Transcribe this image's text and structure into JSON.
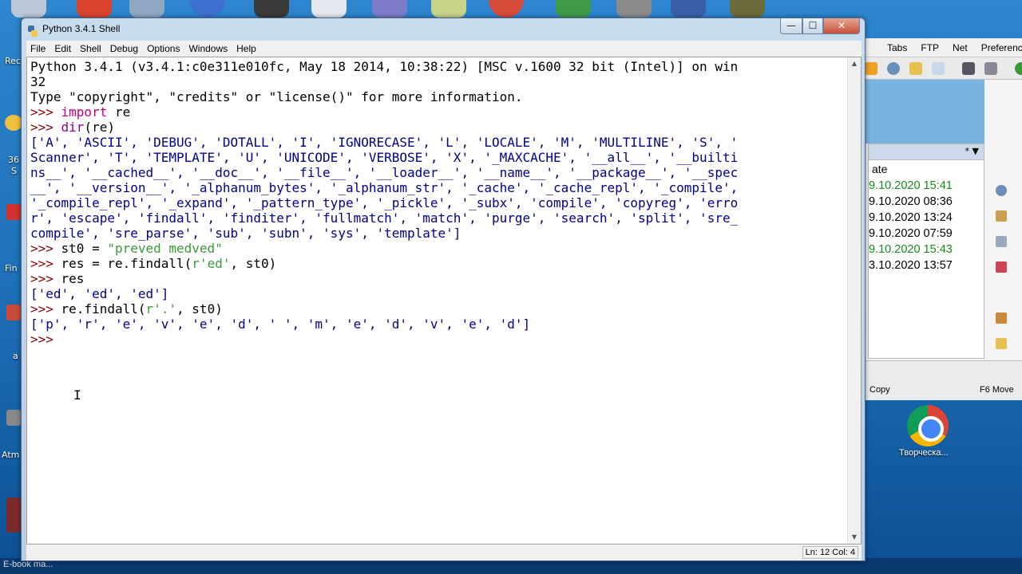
{
  "window": {
    "title": "Python 3.4.1 Shell",
    "minimize_glyph": "—",
    "maximize_glyph": "☐",
    "close_glyph": "✕"
  },
  "menu": [
    "File",
    "Edit",
    "Shell",
    "Debug",
    "Options",
    "Windows",
    "Help"
  ],
  "shell_lines": [
    [
      {
        "t": "Python 3.4.1 (v3.4.1:c0e311e010fc, May 18 2014, 10:38:22) [MSC v.1600 32 bit (Intel)] on win",
        "c": ""
      }
    ],
    [
      {
        "t": "32",
        "c": ""
      }
    ],
    [
      {
        "t": "Type \"copyright\", \"credits\" or \"license()\" for more information.",
        "c": ""
      }
    ],
    [
      {
        "t": ">>> ",
        "c": "prm"
      },
      {
        "t": "import",
        "c": "kw"
      },
      {
        "t": " re",
        "c": ""
      }
    ],
    [
      {
        "t": ">>> ",
        "c": "prm"
      },
      {
        "t": "dir",
        "c": "bi"
      },
      {
        "t": "(re)",
        "c": ""
      }
    ],
    [
      {
        "t": "['A', 'ASCII', 'DEBUG', 'DOTALL', 'I', 'IGNORECASE', 'L', 'LOCALE', 'M', 'MULTILINE', 'S', '",
        "c": "out"
      }
    ],
    [
      {
        "t": "Scanner', 'T', 'TEMPLATE', 'U', 'UNICODE', 'VERBOSE', 'X', '_MAXCACHE', '__all__', '__builti",
        "c": "out"
      }
    ],
    [
      {
        "t": "ns__', '__cached__', '__doc__', '__file__', '__loader__', '__name__', '__package__', '__spec",
        "c": "out"
      }
    ],
    [
      {
        "t": "__', '__version__', '_alphanum_bytes', '_alphanum_str', '_cache', '_cache_repl', '_compile',",
        "c": "out"
      }
    ],
    [
      {
        "t": "'_compile_repl', '_expand', '_pattern_type', '_pickle', '_subx', 'compile', 'copyreg', 'erro",
        "c": "out"
      }
    ],
    [
      {
        "t": "r', 'escape', 'findall', 'finditer', 'fullmatch', 'match', 'purge', 'search', 'split', 'sre_",
        "c": "out"
      }
    ],
    [
      {
        "t": "compile', 'sre_parse', 'sub', 'subn', 'sys', 'template']",
        "c": "out"
      }
    ],
    [
      {
        "t": ">>> ",
        "c": "prm"
      },
      {
        "t": "st0 = ",
        "c": ""
      },
      {
        "t": "\"preved medved\"",
        "c": "str"
      }
    ],
    [
      {
        "t": ">>> ",
        "c": "prm"
      },
      {
        "t": "res = re.findall(",
        "c": ""
      },
      {
        "t": "r'ed'",
        "c": "str"
      },
      {
        "t": ", st0)",
        "c": ""
      }
    ],
    [
      {
        "t": ">>> ",
        "c": "prm"
      },
      {
        "t": "res",
        "c": ""
      }
    ],
    [
      {
        "t": "['ed', 'ed', 'ed']",
        "c": "out"
      }
    ],
    [
      {
        "t": ">>> ",
        "c": "prm"
      },
      {
        "t": "re.findall(",
        "c": ""
      },
      {
        "t": "r'.'",
        "c": "str"
      },
      {
        "t": ", st0)",
        "c": ""
      }
    ],
    [
      {
        "t": "['p', 'r', 'e', 'v', 'e', 'd', ' ', 'm', 'e', 'd', 'v', 'e', 'd']",
        "c": "out"
      }
    ],
    [
      {
        "t": ">>> ",
        "c": "prm"
      }
    ]
  ],
  "status": {
    "position": "Ln: 12 Col: 4"
  },
  "background_app": {
    "menu": [
      "Tabs",
      "FTP",
      "Net",
      "Preferences"
    ],
    "column_header": "ate",
    "rows": [
      {
        "text": "9.10.2020 15:41",
        "color": "#1a8a1a"
      },
      {
        "text": "9.10.2020 08:36",
        "color": "#000000"
      },
      {
        "text": "9.10.2020 13:24",
        "color": "#000000"
      },
      {
        "text": "9.10.2020 07:59",
        "color": "#000000"
      },
      {
        "text": "9.10.2020 15:43",
        "color": "#1a8a1a"
      },
      {
        "text": "3.10.2020 13:57",
        "color": "#000000"
      }
    ],
    "bottom_left": "Copy",
    "bottom_right": "F6 Move",
    "head_glyph": "* ▼"
  },
  "desktop": {
    "chrome_label": "Творческа...",
    "left_labels": [
      "Rec",
      "36",
      "S",
      "Fin",
      "a",
      "Atm"
    ],
    "taskbar_text": "E-book ma..."
  }
}
